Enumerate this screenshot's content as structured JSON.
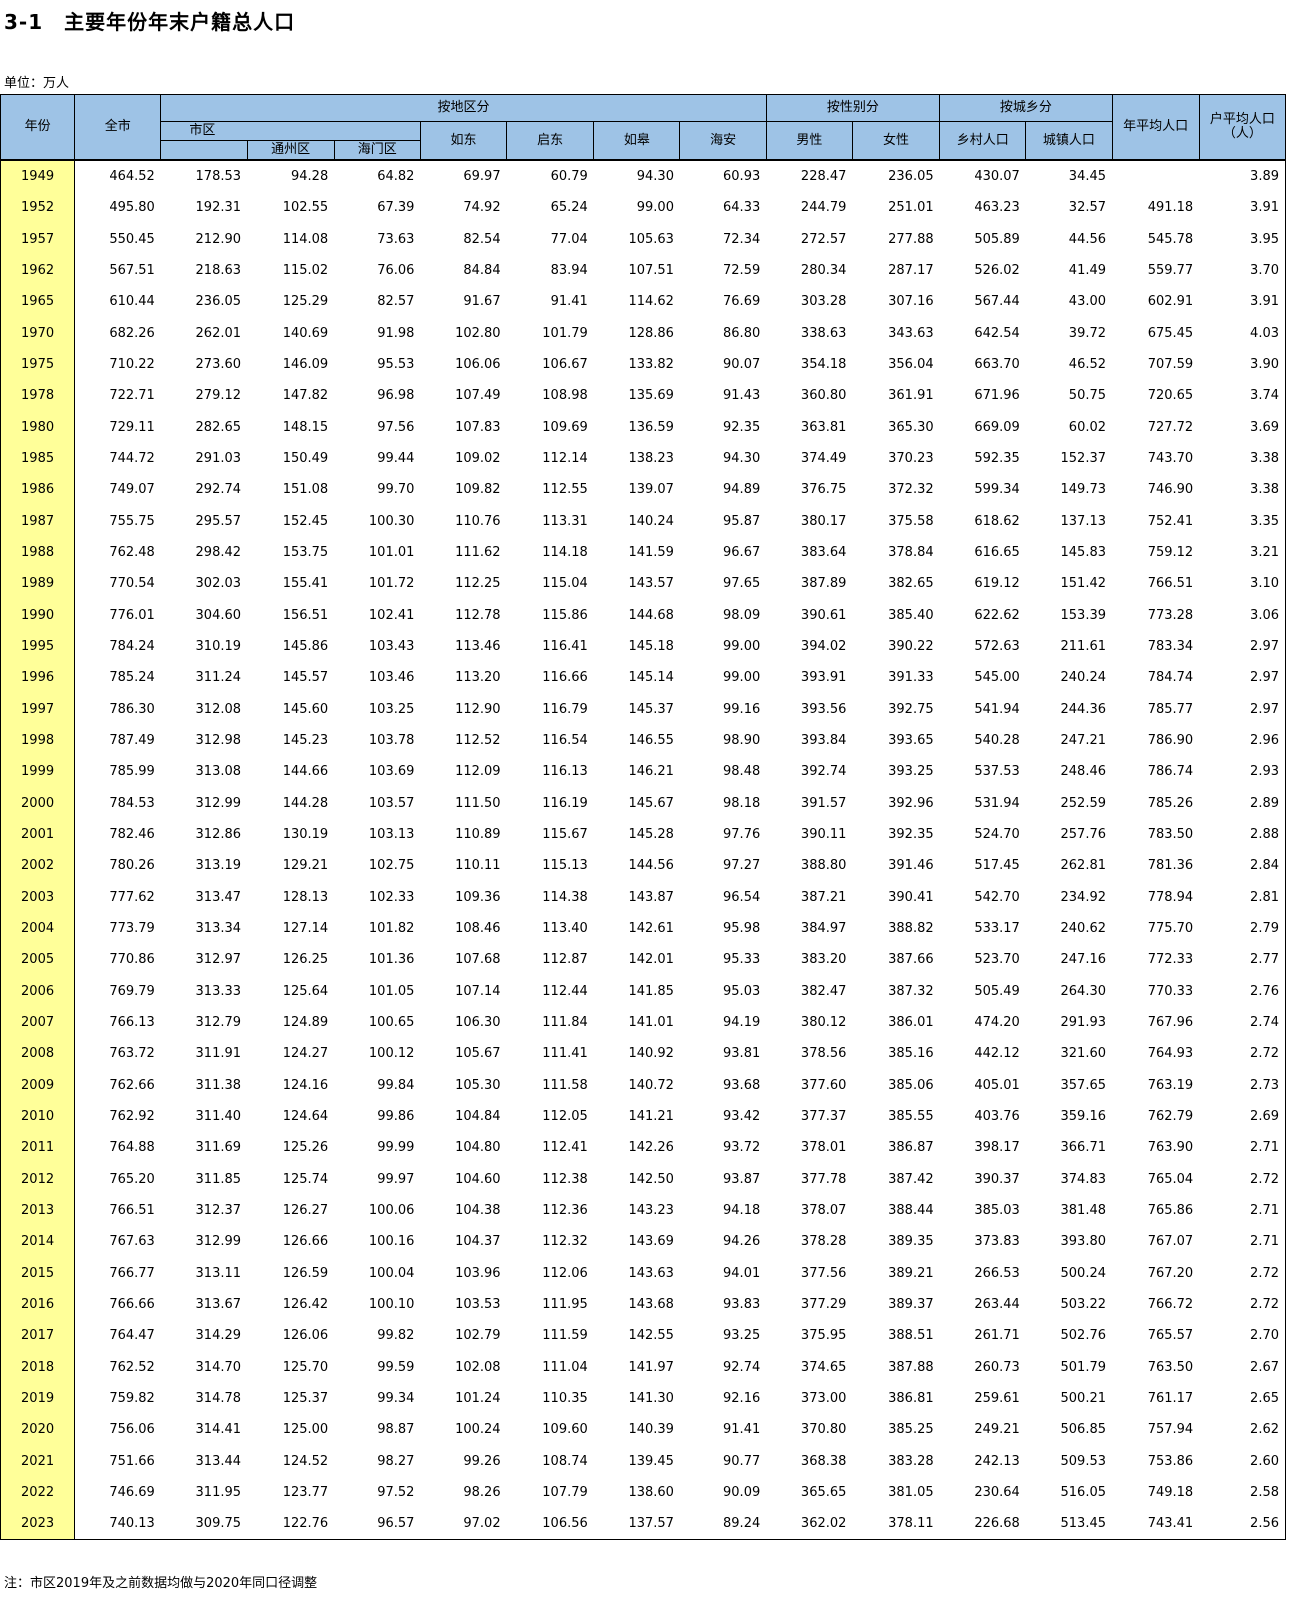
{
  "title": "3-1　主要年份年末户籍总人口",
  "unit": "单位：万人",
  "note": "注：市区2019年及之前数据均做与2020年同口径调整",
  "headers": {
    "year": "年份",
    "total": "全市",
    "by_region": "按地区分",
    "by_gender": "按性别分",
    "by_urban_rural": "按城乡分",
    "urban_district": "市区",
    "tongzhou": "通州区",
    "haimen": "海门区",
    "rudong": "如东",
    "qidong": "启东",
    "rugao": "如皋",
    "haian": "海安",
    "male": "男性",
    "female": "女性",
    "rural": "乡村人口",
    "urban": "城镇人口",
    "annual_avg": "年平均人口",
    "household_avg": "户平均人口（人）"
  },
  "rows": [
    [
      "1949",
      "464.52",
      "178.53",
      "94.28",
      "64.82",
      "69.97",
      "60.79",
      "94.30",
      "60.93",
      "228.47",
      "236.05",
      "430.07",
      "34.45",
      "",
      "3.89"
    ],
    [
      "1952",
      "495.80",
      "192.31",
      "102.55",
      "67.39",
      "74.92",
      "65.24",
      "99.00",
      "64.33",
      "244.79",
      "251.01",
      "463.23",
      "32.57",
      "491.18",
      "3.91"
    ],
    [
      "1957",
      "550.45",
      "212.90",
      "114.08",
      "73.63",
      "82.54",
      "77.04",
      "105.63",
      "72.34",
      "272.57",
      "277.88",
      "505.89",
      "44.56",
      "545.78",
      "3.95"
    ],
    [
      "1962",
      "567.51",
      "218.63",
      "115.02",
      "76.06",
      "84.84",
      "83.94",
      "107.51",
      "72.59",
      "280.34",
      "287.17",
      "526.02",
      "41.49",
      "559.77",
      "3.70"
    ],
    [
      "1965",
      "610.44",
      "236.05",
      "125.29",
      "82.57",
      "91.67",
      "91.41",
      "114.62",
      "76.69",
      "303.28",
      "307.16",
      "567.44",
      "43.00",
      "602.91",
      "3.91"
    ],
    [
      "1970",
      "682.26",
      "262.01",
      "140.69",
      "91.98",
      "102.80",
      "101.79",
      "128.86",
      "86.80",
      "338.63",
      "343.63",
      "642.54",
      "39.72",
      "675.45",
      "4.03"
    ],
    [
      "1975",
      "710.22",
      "273.60",
      "146.09",
      "95.53",
      "106.06",
      "106.67",
      "133.82",
      "90.07",
      "354.18",
      "356.04",
      "663.70",
      "46.52",
      "707.59",
      "3.90"
    ],
    [
      "1978",
      "722.71",
      "279.12",
      "147.82",
      "96.98",
      "107.49",
      "108.98",
      "135.69",
      "91.43",
      "360.80",
      "361.91",
      "671.96",
      "50.75",
      "720.65",
      "3.74"
    ],
    [
      "1980",
      "729.11",
      "282.65",
      "148.15",
      "97.56",
      "107.83",
      "109.69",
      "136.59",
      "92.35",
      "363.81",
      "365.30",
      "669.09",
      "60.02",
      "727.72",
      "3.69"
    ],
    [
      "1985",
      "744.72",
      "291.03",
      "150.49",
      "99.44",
      "109.02",
      "112.14",
      "138.23",
      "94.30",
      "374.49",
      "370.23",
      "592.35",
      "152.37",
      "743.70",
      "3.38"
    ],
    [
      "1986",
      "749.07",
      "292.74",
      "151.08",
      "99.70",
      "109.82",
      "112.55",
      "139.07",
      "94.89",
      "376.75",
      "372.32",
      "599.34",
      "149.73",
      "746.90",
      "3.38"
    ],
    [
      "1987",
      "755.75",
      "295.57",
      "152.45",
      "100.30",
      "110.76",
      "113.31",
      "140.24",
      "95.87",
      "380.17",
      "375.58",
      "618.62",
      "137.13",
      "752.41",
      "3.35"
    ],
    [
      "1988",
      "762.48",
      "298.42",
      "153.75",
      "101.01",
      "111.62",
      "114.18",
      "141.59",
      "96.67",
      "383.64",
      "378.84",
      "616.65",
      "145.83",
      "759.12",
      "3.21"
    ],
    [
      "1989",
      "770.54",
      "302.03",
      "155.41",
      "101.72",
      "112.25",
      "115.04",
      "143.57",
      "97.65",
      "387.89",
      "382.65",
      "619.12",
      "151.42",
      "766.51",
      "3.10"
    ],
    [
      "1990",
      "776.01",
      "304.60",
      "156.51",
      "102.41",
      "112.78",
      "115.86",
      "144.68",
      "98.09",
      "390.61",
      "385.40",
      "622.62",
      "153.39",
      "773.28",
      "3.06"
    ],
    [
      "1995",
      "784.24",
      "310.19",
      "145.86",
      "103.43",
      "113.46",
      "116.41",
      "145.18",
      "99.00",
      "394.02",
      "390.22",
      "572.63",
      "211.61",
      "783.34",
      "2.97"
    ],
    [
      "1996",
      "785.24",
      "311.24",
      "145.57",
      "103.46",
      "113.20",
      "116.66",
      "145.14",
      "99.00",
      "393.91",
      "391.33",
      "545.00",
      "240.24",
      "784.74",
      "2.97"
    ],
    [
      "1997",
      "786.30",
      "312.08",
      "145.60",
      "103.25",
      "112.90",
      "116.79",
      "145.37",
      "99.16",
      "393.56",
      "392.75",
      "541.94",
      "244.36",
      "785.77",
      "2.97"
    ],
    [
      "1998",
      "787.49",
      "312.98",
      "145.23",
      "103.78",
      "112.52",
      "116.54",
      "146.55",
      "98.90",
      "393.84",
      "393.65",
      "540.28",
      "247.21",
      "786.90",
      "2.96"
    ],
    [
      "1999",
      "785.99",
      "313.08",
      "144.66",
      "103.69",
      "112.09",
      "116.13",
      "146.21",
      "98.48",
      "392.74",
      "393.25",
      "537.53",
      "248.46",
      "786.74",
      "2.93"
    ],
    [
      "2000",
      "784.53",
      "312.99",
      "144.28",
      "103.57",
      "111.50",
      "116.19",
      "145.67",
      "98.18",
      "391.57",
      "392.96",
      "531.94",
      "252.59",
      "785.26",
      "2.89"
    ],
    [
      "2001",
      "782.46",
      "312.86",
      "130.19",
      "103.13",
      "110.89",
      "115.67",
      "145.28",
      "97.76",
      "390.11",
      "392.35",
      "524.70",
      "257.76",
      "783.50",
      "2.88"
    ],
    [
      "2002",
      "780.26",
      "313.19",
      "129.21",
      "102.75",
      "110.11",
      "115.13",
      "144.56",
      "97.27",
      "388.80",
      "391.46",
      "517.45",
      "262.81",
      "781.36",
      "2.84"
    ],
    [
      "2003",
      "777.62",
      "313.47",
      "128.13",
      "102.33",
      "109.36",
      "114.38",
      "143.87",
      "96.54",
      "387.21",
      "390.41",
      "542.70",
      "234.92",
      "778.94",
      "2.81"
    ],
    [
      "2004",
      "773.79",
      "313.34",
      "127.14",
      "101.82",
      "108.46",
      "113.40",
      "142.61",
      "95.98",
      "384.97",
      "388.82",
      "533.17",
      "240.62",
      "775.70",
      "2.79"
    ],
    [
      "2005",
      "770.86",
      "312.97",
      "126.25",
      "101.36",
      "107.68",
      "112.87",
      "142.01",
      "95.33",
      "383.20",
      "387.66",
      "523.70",
      "247.16",
      "772.33",
      "2.77"
    ],
    [
      "2006",
      "769.79",
      "313.33",
      "125.64",
      "101.05",
      "107.14",
      "112.44",
      "141.85",
      "95.03",
      "382.47",
      "387.32",
      "505.49",
      "264.30",
      "770.33",
      "2.76"
    ],
    [
      "2007",
      "766.13",
      "312.79",
      "124.89",
      "100.65",
      "106.30",
      "111.84",
      "141.01",
      "94.19",
      "380.12",
      "386.01",
      "474.20",
      "291.93",
      "767.96",
      "2.74"
    ],
    [
      "2008",
      "763.72",
      "311.91",
      "124.27",
      "100.12",
      "105.67",
      "111.41",
      "140.92",
      "93.81",
      "378.56",
      "385.16",
      "442.12",
      "321.60",
      "764.93",
      "2.72"
    ],
    [
      "2009",
      "762.66",
      "311.38",
      "124.16",
      "99.84",
      "105.30",
      "111.58",
      "140.72",
      "93.68",
      "377.60",
      "385.06",
      "405.01",
      "357.65",
      "763.19",
      "2.73"
    ],
    [
      "2010",
      "762.92",
      "311.40",
      "124.64",
      "99.86",
      "104.84",
      "112.05",
      "141.21",
      "93.42",
      "377.37",
      "385.55",
      "403.76",
      "359.16",
      "762.79",
      "2.69"
    ],
    [
      "2011",
      "764.88",
      "311.69",
      "125.26",
      "99.99",
      "104.80",
      "112.41",
      "142.26",
      "93.72",
      "378.01",
      "386.87",
      "398.17",
      "366.71",
      "763.90",
      "2.71"
    ],
    [
      "2012",
      "765.20",
      "311.85",
      "125.74",
      "99.97",
      "104.60",
      "112.38",
      "142.50",
      "93.87",
      "377.78",
      "387.42",
      "390.37",
      "374.83",
      "765.04",
      "2.72"
    ],
    [
      "2013",
      "766.51",
      "312.37",
      "126.27",
      "100.06",
      "104.38",
      "112.36",
      "143.23",
      "94.18",
      "378.07",
      "388.44",
      "385.03",
      "381.48",
      "765.86",
      "2.71"
    ],
    [
      "2014",
      "767.63",
      "312.99",
      "126.66",
      "100.16",
      "104.37",
      "112.32",
      "143.69",
      "94.26",
      "378.28",
      "389.35",
      "373.83",
      "393.80",
      "767.07",
      "2.71"
    ],
    [
      "2015",
      "766.77",
      "313.11",
      "126.59",
      "100.04",
      "103.96",
      "112.06",
      "143.63",
      "94.01",
      "377.56",
      "389.21",
      "266.53",
      "500.24",
      "767.20",
      "2.72"
    ],
    [
      "2016",
      "766.66",
      "313.67",
      "126.42",
      "100.10",
      "103.53",
      "111.95",
      "143.68",
      "93.83",
      "377.29",
      "389.37",
      "263.44",
      "503.22",
      "766.72",
      "2.72"
    ],
    [
      "2017",
      "764.47",
      "314.29",
      "126.06",
      "99.82",
      "102.79",
      "111.59",
      "142.55",
      "93.25",
      "375.95",
      "388.51",
      "261.71",
      "502.76",
      "765.57",
      "2.70"
    ],
    [
      "2018",
      "762.52",
      "314.70",
      "125.70",
      "99.59",
      "102.08",
      "111.04",
      "141.97",
      "92.74",
      "374.65",
      "387.88",
      "260.73",
      "501.79",
      "763.50",
      "2.67"
    ],
    [
      "2019",
      "759.82",
      "314.78",
      "125.37",
      "99.34",
      "101.24",
      "110.35",
      "141.30",
      "92.16",
      "373.00",
      "386.81",
      "259.61",
      "500.21",
      "761.17",
      "2.65"
    ],
    [
      "2020",
      "756.06",
      "314.41",
      "125.00",
      "98.87",
      "100.24",
      "109.60",
      "140.39",
      "91.41",
      "370.80",
      "385.25",
      "249.21",
      "506.85",
      "757.94",
      "2.62"
    ],
    [
      "2021",
      "751.66",
      "313.44",
      "124.52",
      "98.27",
      "99.26",
      "108.74",
      "139.45",
      "90.77",
      "368.38",
      "383.28",
      "242.13",
      "509.53",
      "753.86",
      "2.60"
    ],
    [
      "2022",
      "746.69",
      "311.95",
      "123.77",
      "97.52",
      "98.26",
      "107.79",
      "138.60",
      "90.09",
      "365.65",
      "381.05",
      "230.64",
      "516.05",
      "749.18",
      "2.58"
    ],
    [
      "2023",
      "740.13",
      "309.75",
      "122.76",
      "96.57",
      "97.02",
      "106.56",
      "137.57",
      "89.24",
      "362.02",
      "378.11",
      "226.68",
      "513.45",
      "743.41",
      "2.56"
    ]
  ]
}
